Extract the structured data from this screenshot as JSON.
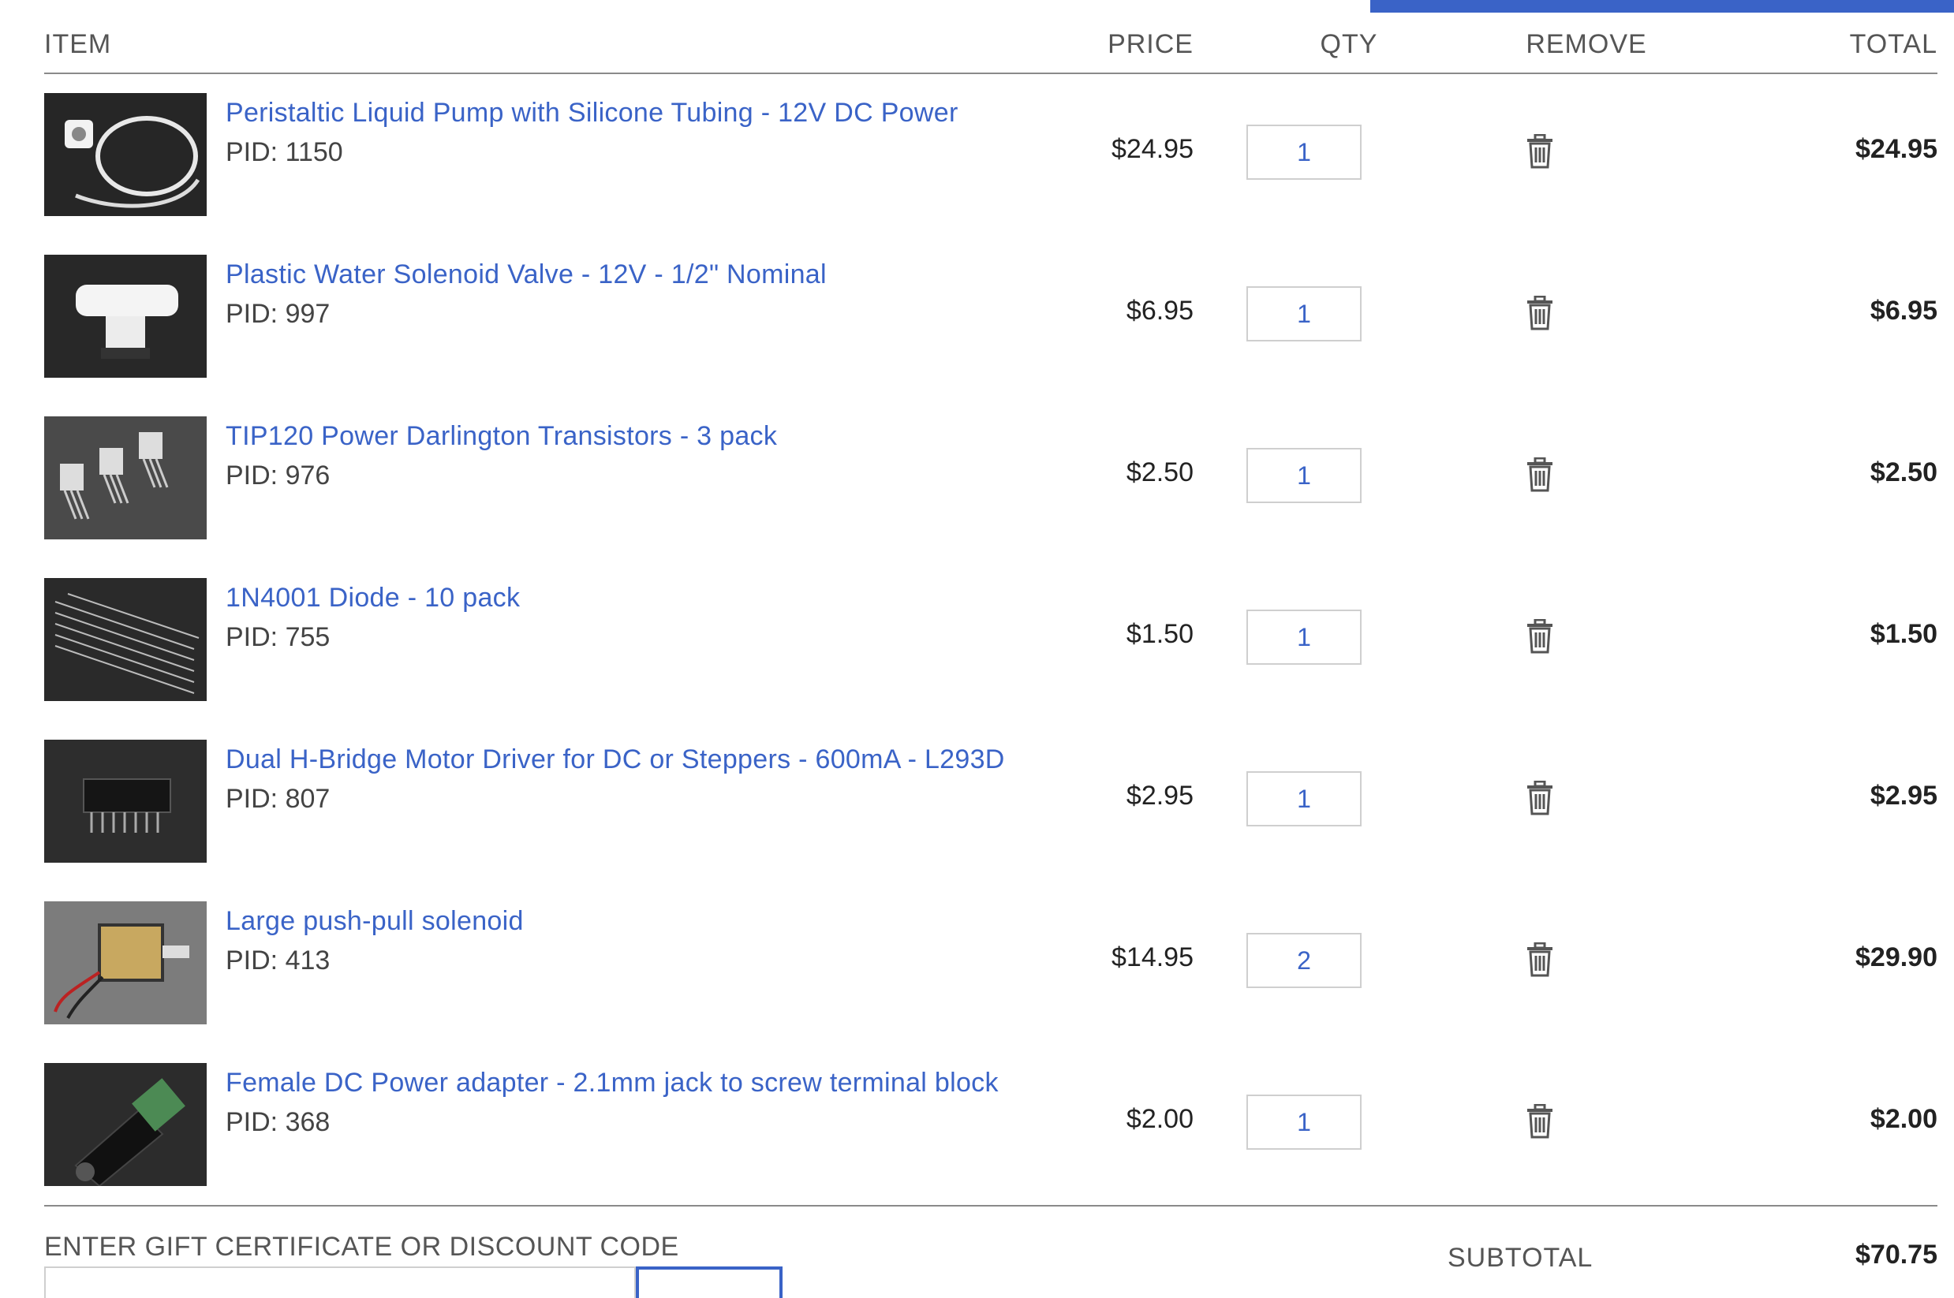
{
  "header": {
    "item": "ITEM",
    "price": "PRICE",
    "qty": "QTY",
    "remove": "REMOVE",
    "total": "TOTAL"
  },
  "items": [
    {
      "name": "Peristaltic Liquid Pump with Silicone Tubing - 12V DC Power",
      "pid": "PID: 1150",
      "price": "$24.95",
      "qty": "1",
      "total": "$24.95"
    },
    {
      "name": "Plastic Water Solenoid Valve - 12V - 1/2\" Nominal",
      "pid": "PID: 997",
      "price": "$6.95",
      "qty": "1",
      "total": "$6.95"
    },
    {
      "name": "TIP120 Power Darlington Transistors - 3 pack",
      "pid": "PID: 976",
      "price": "$2.50",
      "qty": "1",
      "total": "$2.50"
    },
    {
      "name": "1N4001 Diode - 10 pack",
      "pid": "PID: 755",
      "price": "$1.50",
      "qty": "1",
      "total": "$1.50"
    },
    {
      "name": "Dual H-Bridge Motor Driver for DC or Steppers - 600mA - L293D",
      "pid": "PID: 807",
      "price": "$2.95",
      "qty": "1",
      "total": "$2.95"
    },
    {
      "name": "Large push-pull solenoid",
      "pid": "PID: 413",
      "price": "$14.95",
      "qty": "2",
      "total": "$29.90"
    },
    {
      "name": "Female DC Power adapter - 2.1mm jack to screw terminal block",
      "pid": "PID: 368",
      "price": "$2.00",
      "qty": "1",
      "total": "$2.00"
    }
  ],
  "footer": {
    "gift_label": "ENTER GIFT CERTIFICATE OR DISCOUNT CODE",
    "subtotal_label": "SUBTOTAL",
    "subtotal_value": "$70.75"
  },
  "colors": {
    "link": "#3a63c7",
    "accent_bar": "#3a63c7"
  },
  "icons": {
    "remove": "trash-icon"
  }
}
